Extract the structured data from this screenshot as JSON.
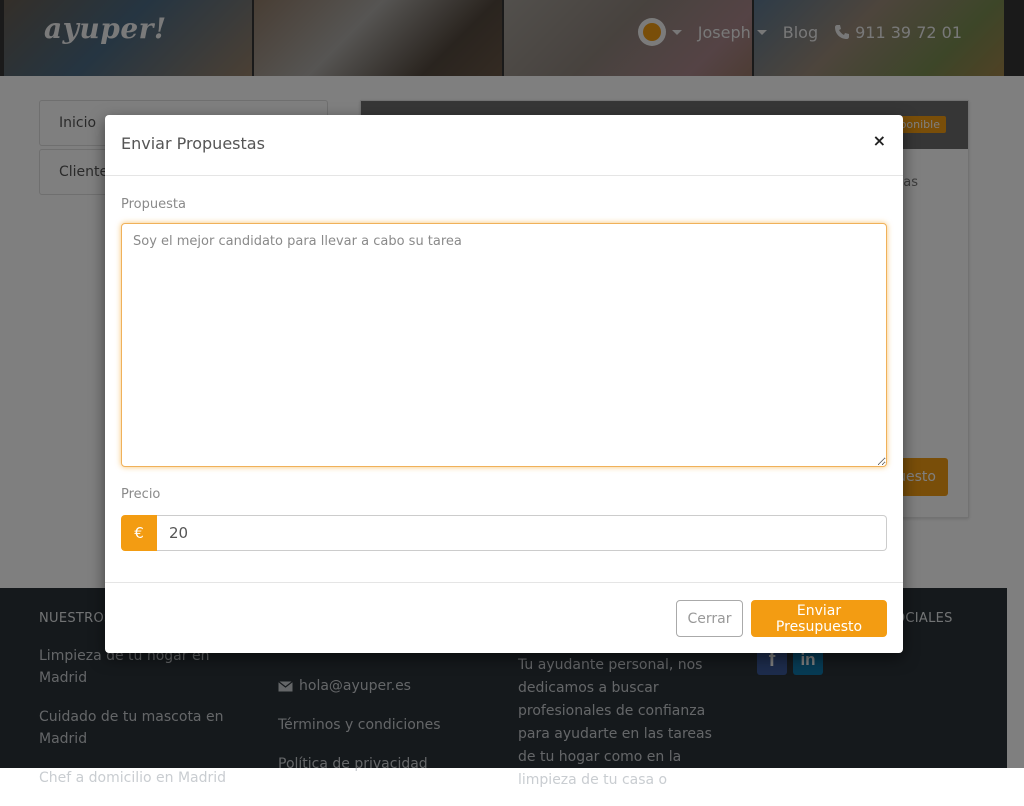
{
  "header": {
    "logo": "ayuper!",
    "user_name": "Joseph",
    "blog_label": "Blog",
    "phone": "911 39 72 01",
    "icons": {
      "notifications": "bell-icon",
      "phone": "phone-icon"
    }
  },
  "sidebar": {
    "items": [
      {
        "label": "Inicio"
      },
      {
        "label": "Clientes"
      }
    ]
  },
  "card": {
    "badge": "Disponible",
    "text": "as",
    "button_label": "Presupuesto"
  },
  "footer": {
    "col1": {
      "title": "NUESTROS SERVICIOS",
      "links": [
        "Limpieza de tu hogar en Madrid",
        "Cuidado de tu mascota en Madrid",
        "Chef a domicilio en Madrid"
      ]
    },
    "col2": {
      "email": "hola@ayuper.es",
      "links": [
        "Términos y condiciones",
        "Política de privacidad"
      ]
    },
    "col3": {
      "text": "Tu ayudante personal, nos dedicamos a buscar profesionales de confianza para ayudarte en las tareas de tu hogar como en la limpieza de tu casa o"
    },
    "col4": {
      "title": "AYUPER EN REDES SOCIALES",
      "social": [
        {
          "name": "facebook-icon",
          "glyph": "f"
        },
        {
          "name": "linkedin-icon",
          "glyph": "in"
        }
      ]
    }
  },
  "modal": {
    "title": "Enviar Propuestas",
    "close_glyph": "×",
    "proposal_label": "Propuesta",
    "proposal_placeholder": "Soy el mejor candidato para llevar a cabo su tarea",
    "price_label": "Precio",
    "currency_symbol": "€",
    "price_value": "20",
    "close_button": "Cerrar",
    "send_button": "Enviar Presupuesto"
  },
  "colors": {
    "accent": "#f39c12",
    "footer_bg": "#2b3238",
    "backdrop": "rgba(0,0,0,0.5)"
  }
}
